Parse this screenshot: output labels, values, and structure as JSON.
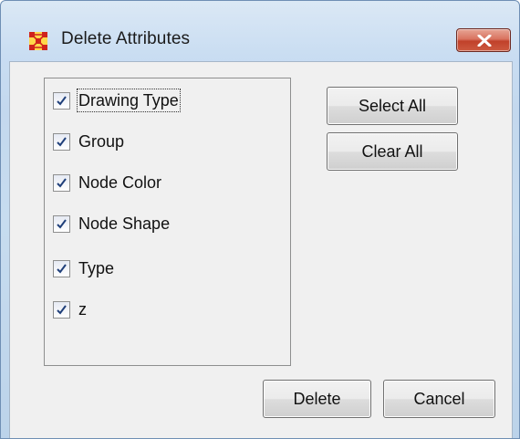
{
  "window": {
    "title": "Delete Attributes",
    "icons": {
      "app": "network-nodes-icon",
      "close": "close-x-icon"
    }
  },
  "attributes": {
    "items": [
      {
        "label": "Drawing Type",
        "checked": true,
        "focused": true
      },
      {
        "label": "Group",
        "checked": true,
        "focused": false
      },
      {
        "label": "Node Color",
        "checked": true,
        "focused": false
      },
      {
        "label": "Node Shape",
        "checked": true,
        "focused": false
      },
      {
        "label": "Type",
        "checked": true,
        "focused": false
      },
      {
        "label": "z",
        "checked": true,
        "focused": false
      }
    ]
  },
  "actions": {
    "select_all": "Select All",
    "clear_all": "Clear All",
    "delete": "Delete",
    "cancel": "Cancel"
  },
  "colors": {
    "title_bar": "#c9ddf2",
    "close_button": "#c1412a",
    "app_icon": "#d0231c",
    "checkmark": "#1f3f7a"
  }
}
